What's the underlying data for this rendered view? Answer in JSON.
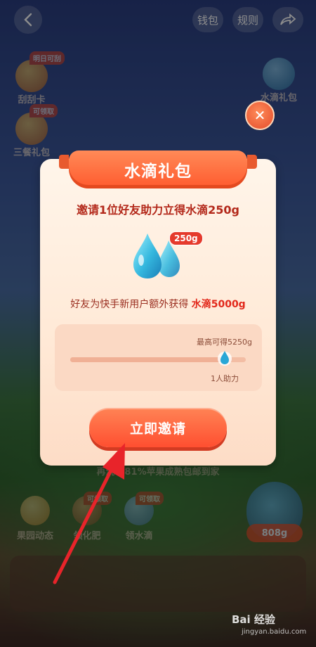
{
  "topbar": {
    "wallet": "钱包",
    "rules": "规则"
  },
  "side_left": [
    {
      "label": "刮刮卡",
      "badge": "明日可刮"
    },
    {
      "label": "三餐礼包",
      "badge": "可领取"
    }
  ],
  "side_right": {
    "label": "水滴礼包"
  },
  "modal": {
    "title": "水滴礼包",
    "headline": "邀请1位好友助力立得水滴250g",
    "amount_badge": "250g",
    "subline_prefix": "好友为快手新用户额外获得 ",
    "subline_highlight": "水滴5000g",
    "max_label": "最高可得5250g",
    "progress_label": "1人助力",
    "progress_fraction": 0.88,
    "invite_button": "立即邀请"
  },
  "background_ui": {
    "hint": "再浇7.81%苹果成熟包邮到家",
    "bottom_items": [
      {
        "label": "果园动态"
      },
      {
        "label": "领化肥",
        "badge": "可领取"
      },
      {
        "label": "领水滴",
        "badge": "可领取"
      }
    ],
    "kettle_value": "808g"
  },
  "watermark": {
    "text": "Bai 经验",
    "sub": "jingyan.baidu.com"
  },
  "colors": {
    "accent": "#ff5a2e",
    "headline": "#b3281a",
    "highlight": "#e2271a",
    "arrow": "#e8242a"
  }
}
